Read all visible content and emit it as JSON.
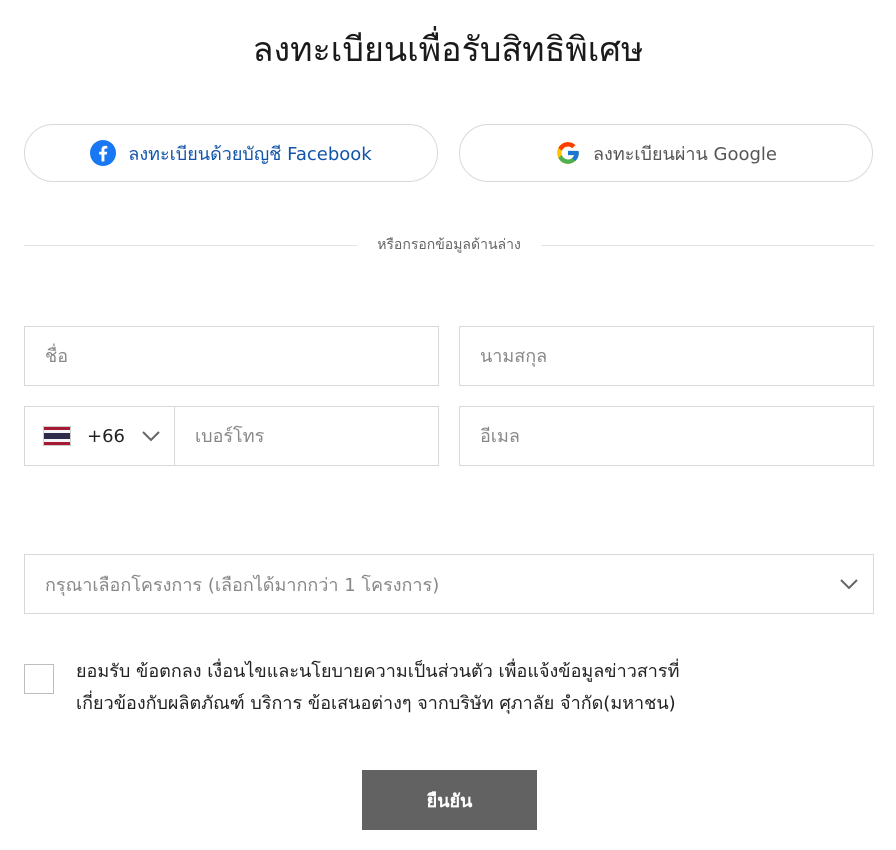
{
  "title": "ลงทะเบียนเพื่อรับสิทธิพิเศษ",
  "social": {
    "facebook": {
      "label": "ลงทะเบียนด้วยบัญชี Facebook",
      "icon": "facebook-icon",
      "color": "#1155aa"
    },
    "google": {
      "label": "ลงทะเบียนผ่าน Google",
      "icon": "google-icon"
    }
  },
  "divider_text": "หรือกรอกข้อมูลด้านล่าง",
  "form": {
    "first_name": {
      "value": "",
      "placeholder": "ชื่อ"
    },
    "last_name": {
      "value": "",
      "placeholder": "นามสกุล"
    },
    "country": {
      "flag": "thailand-flag-icon",
      "code": "+66"
    },
    "phone": {
      "value": "",
      "placeholder": "เบอร์โทร"
    },
    "email": {
      "value": "",
      "placeholder": "อีเมล"
    },
    "project": {
      "placeholder": "กรุณาเลือกโครงการ (เลือกได้มากกว่า 1 โครงการ)"
    }
  },
  "consent": {
    "line1": "ยอมรับ ข้อตกลง เงื่อนไขและนโยบายความเป็นส่วนตัว เพื่อแจ้งข้อมูลข่าวสารที่",
    "line2": "เกี่ยวข้องกับผลิตภัณฑ์ บริการ ข้อเสนอต่างๆ จากบริษัท ศุภาลัย จำกัด(มหาชน)",
    "checked": false
  },
  "submit_label": "ยืนยัน",
  "colors": {
    "submit_bg": "#626262",
    "border": "#d9d9d9",
    "facebook_blue": "#1877f2"
  }
}
